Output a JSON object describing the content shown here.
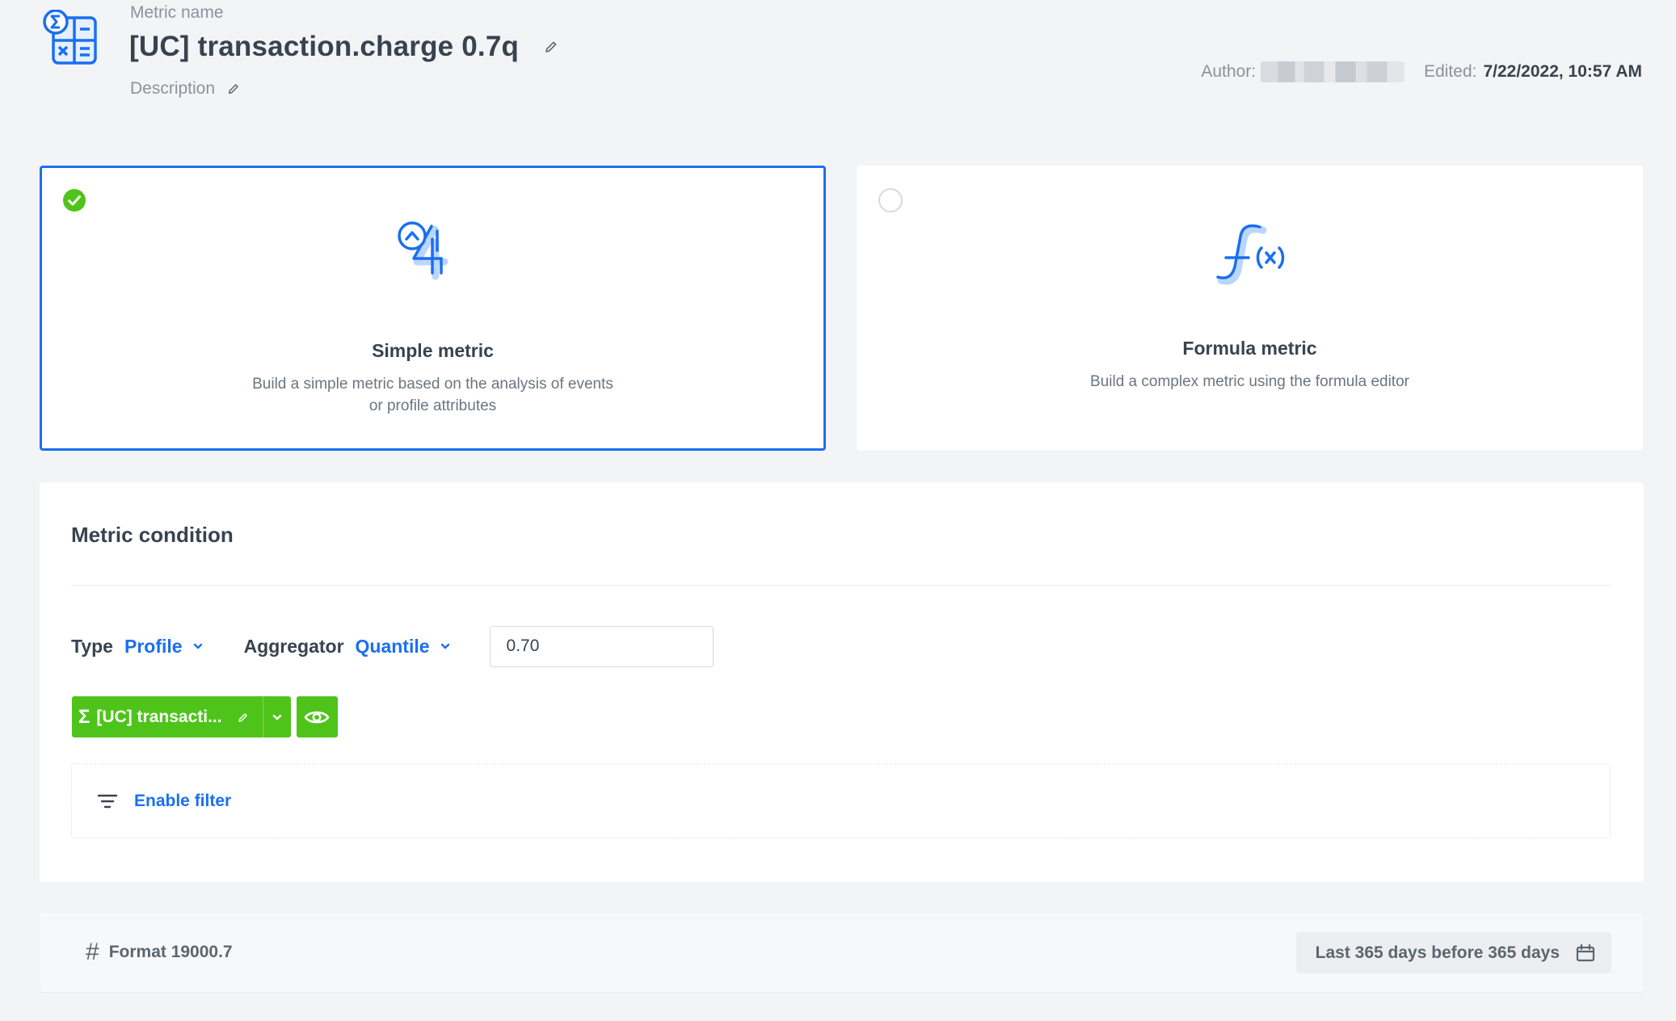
{
  "header": {
    "name_label": "Metric name",
    "title": "[UC] transaction.charge 0.7q",
    "description_label": "Description",
    "author_label": "Author:",
    "edited_label": "Edited:",
    "edited_value": "7/22/2022, 10:57 AM"
  },
  "metric_types": [
    {
      "title": "Simple metric",
      "description": "Build a simple metric based on the analysis of events or profile attributes",
      "selected": true
    },
    {
      "title": "Formula metric",
      "description": "Build a complex metric using the formula editor",
      "selected": false
    }
  ],
  "condition": {
    "title": "Metric condition",
    "type_label": "Type",
    "type_value": "Profile",
    "aggregator_label": "Aggregator",
    "aggregator_value": "Quantile",
    "quantile_value": "0.70",
    "attribute_pill": "[UC] transacti...",
    "enable_filter": "Enable filter"
  },
  "footer": {
    "format": "Format 19000.7",
    "date_range": "Last 365 days before 365 days"
  },
  "colors": {
    "accent": "#1a6ff0",
    "success": "#4ec41b",
    "text": "#384350",
    "muted": "#8a939d"
  }
}
